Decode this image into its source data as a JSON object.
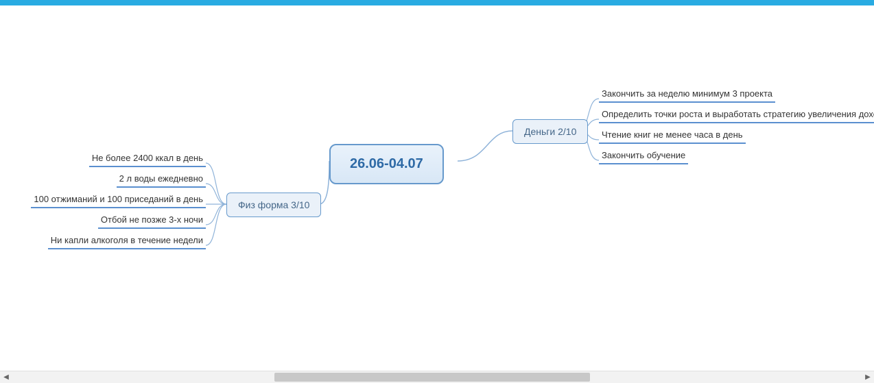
{
  "center": {
    "label": "26.06-04.07"
  },
  "branches": {
    "left": {
      "label": "Физ форма 3/10",
      "leaves": [
        "Не более 2400 ккал в день",
        "2 л воды ежедневно",
        "100 отжиманий и 100 приседаний в день",
        "Отбой не позже 3-х ночи",
        "Ни капли алкоголя в течение недели"
      ]
    },
    "right": {
      "label": "Деньги 2/10",
      "leaves": [
        "Закончить за неделю минимум 3 проекта",
        "Определить точки роста и выработать стратегию увеличения дохода",
        "Чтение книг не менее часа в день",
        "Закончить обучение"
      ]
    }
  },
  "colors": {
    "top_bar": "#29abe2",
    "node_border": "#6699cc",
    "node_text": "#2e6aa6",
    "leaf_underline": "#5a8fcf"
  }
}
